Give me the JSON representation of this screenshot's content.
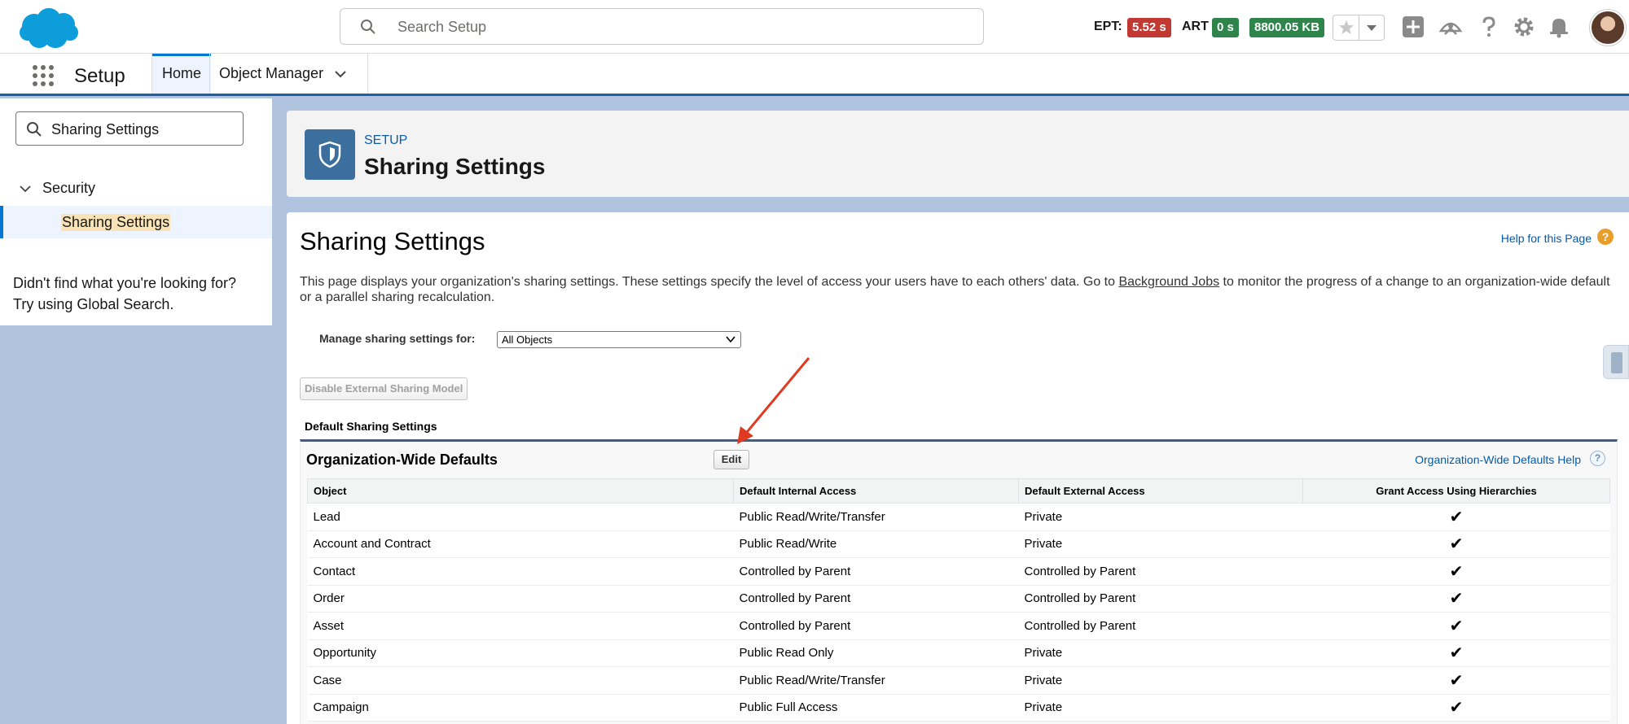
{
  "header": {
    "search_placeholder": "Search Setup",
    "metrics": [
      {
        "label": "EPT:",
        "value": "5.52 s",
        "color": "#c23934"
      },
      {
        "label": "ART",
        "value": "0 s",
        "color": "#2e844a"
      },
      {
        "value": "8800.05 KB",
        "color": "#2e844a"
      }
    ],
    "icons": [
      "favorite-star-icon",
      "favorites-dropdown-icon",
      "add-icon",
      "trailhead-icon",
      "help-icon",
      "gear-icon",
      "notifications-bell-icon",
      "avatar"
    ]
  },
  "nav": {
    "app_name": "Setup",
    "tabs": [
      {
        "label": "Home",
        "active": true
      },
      {
        "label": "Object Manager",
        "active": false
      }
    ]
  },
  "sidebar": {
    "quickfind_value": "Sharing Settings",
    "section": "Security",
    "item": "Sharing Settings",
    "not_found_line1": "Didn't find what you're looking for?",
    "not_found_line2": "Try using Global Search."
  },
  "page_header": {
    "label": "SETUP",
    "title": "Sharing Settings"
  },
  "content": {
    "title": "Sharing Settings",
    "help_link": "Help for this Page",
    "desc_before": "This page displays your organization's sharing settings. These settings specify the level of access your users have to each others' data. Go to ",
    "desc_link": "Background Jobs",
    "desc_after": " to monitor the progress of a change to an organization-wide default or a parallel sharing recalculation.",
    "manage_label": "Manage sharing settings for:",
    "manage_value": "All Objects",
    "disable_button": "Disable External Sharing Model",
    "section_label": "Default Sharing Settings",
    "block_title": "Organization-Wide Defaults",
    "edit_button": "Edit",
    "owd_help": "Organization-Wide Defaults Help",
    "columns": [
      "Object",
      "Default Internal Access",
      "Default External Access",
      "Grant Access Using Hierarchies"
    ],
    "rows": [
      {
        "object": "Lead",
        "internal": "Public Read/Write/Transfer",
        "external": "Private",
        "grant": "✔"
      },
      {
        "object": "Account and Contract",
        "internal": "Public Read/Write",
        "external": "Private",
        "grant": "✔"
      },
      {
        "object": "Contact",
        "internal": "Controlled by Parent",
        "external": "Controlled by Parent",
        "grant": "✔"
      },
      {
        "object": "Order",
        "internal": "Controlled by Parent",
        "external": "Controlled by Parent",
        "grant": "✔"
      },
      {
        "object": "Asset",
        "internal": "Controlled by Parent",
        "external": "Controlled by Parent",
        "grant": "✔"
      },
      {
        "object": "Opportunity",
        "internal": "Public Read Only",
        "external": "Private",
        "grant": "✔"
      },
      {
        "object": "Case",
        "internal": "Public Read/Write/Transfer",
        "external": "Private",
        "grant": "✔"
      },
      {
        "object": "Campaign",
        "internal": "Public Full Access",
        "external": "Private",
        "grant": "✔"
      }
    ]
  }
}
